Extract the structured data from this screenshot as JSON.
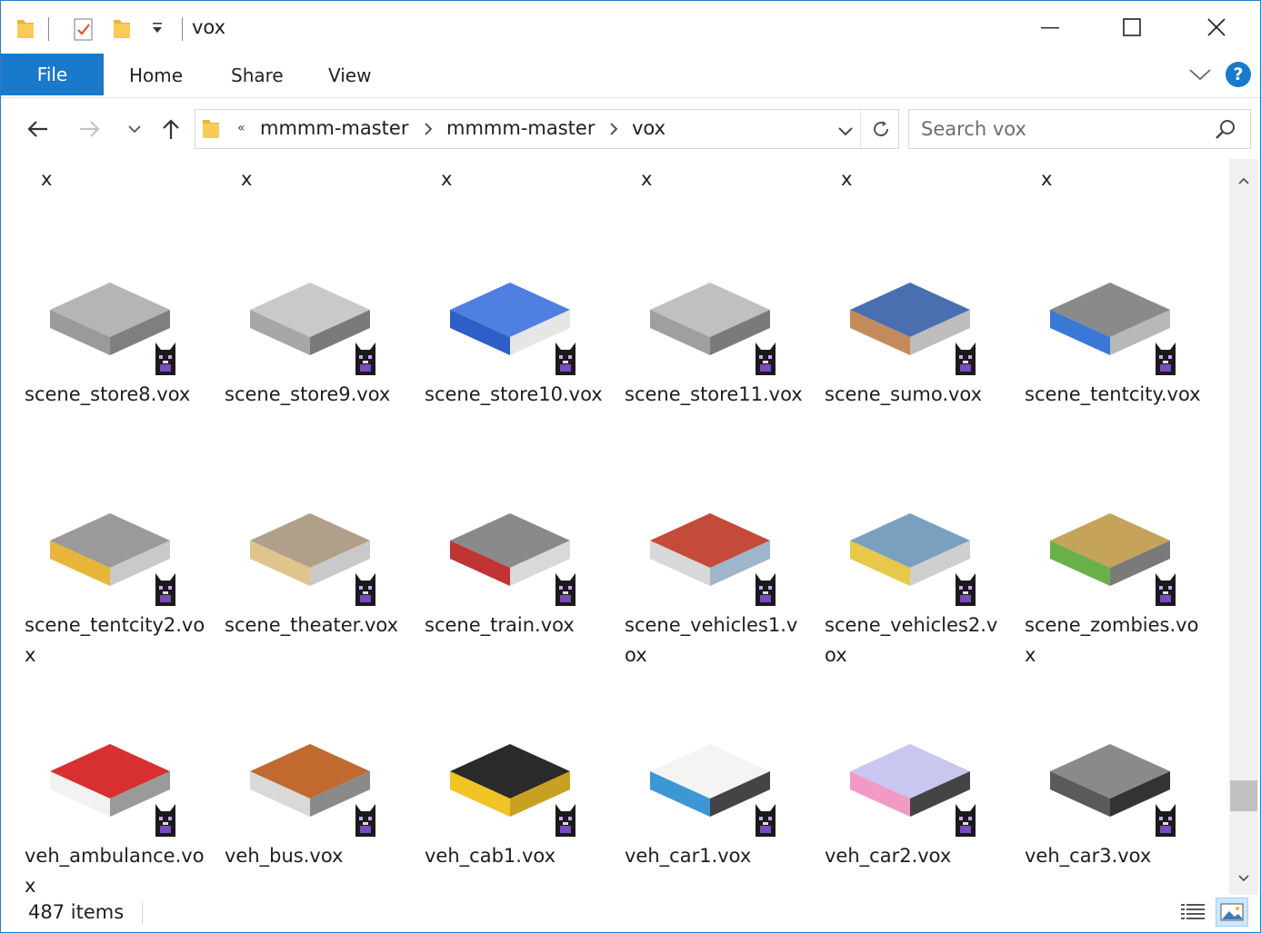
{
  "window": {
    "title": "vox"
  },
  "ribbon": {
    "tabs": [
      {
        "label": "File"
      },
      {
        "label": "Home"
      },
      {
        "label": "Share"
      },
      {
        "label": "View"
      }
    ],
    "help_label": "?"
  },
  "address": {
    "overflow": "«",
    "crumbs": [
      "mmmm-master",
      "mmmm-master",
      "vox"
    ]
  },
  "search": {
    "placeholder": "Search vox"
  },
  "partial_row": [
    "x",
    "x",
    "x",
    "x",
    "x",
    "x"
  ],
  "files": [
    {
      "name": "scene_store8.vox"
    },
    {
      "name": "scene_store9.vox"
    },
    {
      "name": "scene_store10.vox"
    },
    {
      "name": "scene_store11.vox"
    },
    {
      "name": "scene_sumo.vox"
    },
    {
      "name": "scene_tentcity.vox"
    },
    {
      "name": "scene_tentcity2.vox"
    },
    {
      "name": "scene_theater.vox"
    },
    {
      "name": "scene_train.vox"
    },
    {
      "name": "scene_vehicles1.vox"
    },
    {
      "name": "scene_vehicles2.vox"
    },
    {
      "name": "scene_zombies.vox"
    },
    {
      "name": "veh_ambulance.vox"
    },
    {
      "name": "veh_bus.vox"
    },
    {
      "name": "veh_cab1.vox"
    },
    {
      "name": "veh_car1.vox"
    },
    {
      "name": "veh_car2.vox"
    },
    {
      "name": "veh_car3.vox"
    }
  ],
  "status": {
    "item_count": "487 items"
  },
  "colors": {
    "accent": "#1979ca",
    "selection": "#cce8ff",
    "folder": "#f5c242"
  },
  "icons": {
    "file_type": "vox-cat-icon",
    "details_view": "details-view-icon",
    "large_icons_view": "large-icons-view-icon"
  }
}
